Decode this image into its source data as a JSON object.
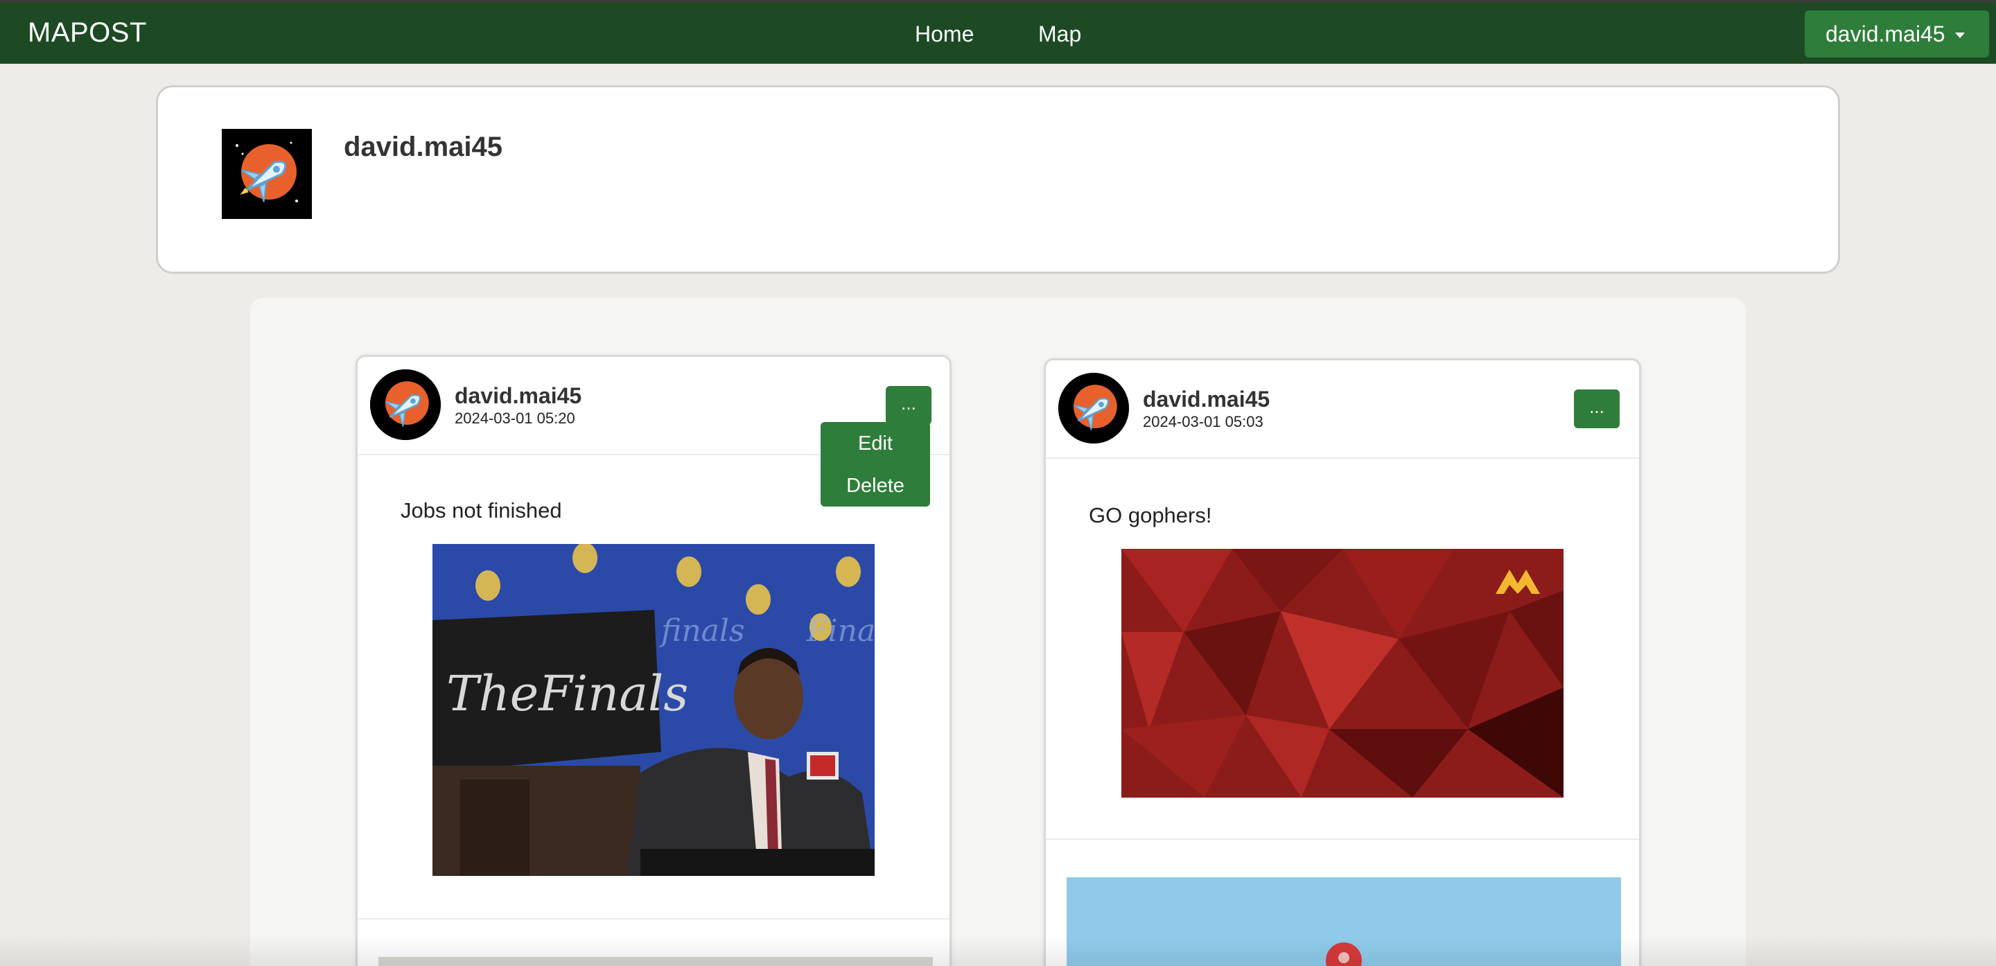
{
  "navbar": {
    "brand": "MAPOST",
    "links": [
      "Home",
      "Map"
    ],
    "user_menu": "david.mai45",
    "bg_color": "#1d4a24",
    "accent_color": "#2e7d3a"
  },
  "profile": {
    "username": "david.mai45",
    "avatar_icon": "rocket-avatar-icon"
  },
  "posts": [
    {
      "username": "david.mai45",
      "timestamp": "2024-03-01 05:20",
      "more_label": "...",
      "text": "Jobs not finished",
      "menu": [
        "Edit",
        "Delete"
      ],
      "image": "press-conference-photo"
    },
    {
      "username": "david.mai45",
      "timestamp": "2024-03-01 05:03",
      "more_label": "...",
      "text": "GO gophers!",
      "image": "minnesota-gophers-banner"
    }
  ]
}
